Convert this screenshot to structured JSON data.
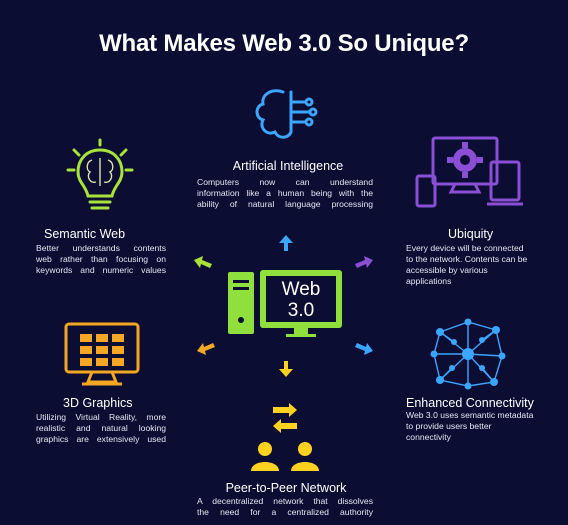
{
  "title": "What Makes Web 3.0 So Unique?",
  "center": {
    "line1": "Web",
    "line2": "3.0"
  },
  "features": {
    "ai": {
      "label": "Artificial Intelligence",
      "lines": [
        "Computers now can understand",
        "information like a human being with the",
        "ability of natural language processing"
      ]
    },
    "semantic": {
      "label": "Semantic Web",
      "lines": [
        "Better understands contents",
        "web rather than focusing on",
        "keywords and numeric values"
      ]
    },
    "ubiquity": {
      "label": "Ubiquity",
      "lines": [
        "Every device will be connected",
        "to the network. Contents can be",
        "accessible by various",
        "applications"
      ]
    },
    "graphics": {
      "label": "3D Graphics",
      "lines": [
        "Utilizing Virtual Reality, more",
        "realistic and natural looking",
        "graphics are extensively used"
      ]
    },
    "connectivity": {
      "label": "Enhanced Connectivity",
      "lines": [
        "Web 3.0 uses semantic metadata",
        "to provide users better",
        "connectivity"
      ]
    },
    "p2p": {
      "label": "Peer-to-Peer Network",
      "lines": [
        "A decentralized network that dissolves",
        "the need for a centralized authority"
      ]
    }
  },
  "colors": {
    "background": "#0b0d33",
    "ai": "#3aa6ff",
    "semantic": "#a8e23a",
    "ubiquity": "#8b4fd6",
    "graphics": "#f5a623",
    "connectivity": "#3aa6ff",
    "p2p": "#ffd21f",
    "computer": "#8fe03d"
  },
  "icons": [
    "cloud-network-icon",
    "brain-bulb-icon",
    "devices-gear-icon",
    "monitor-grid-icon",
    "network-people-icon",
    "peer-exchange-icon",
    "computer-icon"
  ]
}
